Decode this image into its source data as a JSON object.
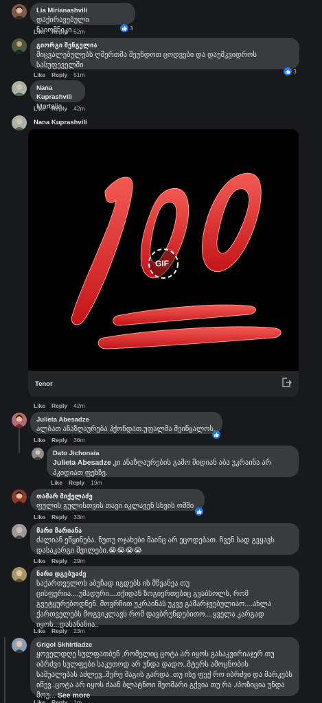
{
  "ui": {
    "like": "Like",
    "reply": "Reply",
    "like_color": "#1877f2",
    "bubble_color": "#3a3b3c",
    "background": "#18191a"
  },
  "comments": [
    {
      "author": "Lia Mirianashvili",
      "text": "დაქირავებული ნაიომნიკი..",
      "time": "52m",
      "reaction_count": "3"
    },
    {
      "author": "გიორგი შენგელია",
      "text": "მიცვალებულებს ღმერთმა შეუნდოთ ცოდვები და დაუმკვიდროს სასუფეველში",
      "time": "51m",
      "reaction_count": "3"
    },
    {
      "author": "Nana Kuprashvili",
      "text": "Martalia",
      "time": "42m"
    },
    {
      "author": "Nana Kuprashvili",
      "gif_label": "GIF",
      "gif_source": "Tenor",
      "gif_number": "100",
      "time": "42m"
    },
    {
      "author": "Julieta Abesadze",
      "text": "ალბათ ანაზღაურება ჰქონდათ.უფალმა შეიწყალოს.",
      "time": "36m"
    },
    {
      "author": "Dato Jichonaia",
      "mention": "Julieta Abesadze",
      "text": " კი ანაზღაურების გამო მიდიან აბა უკრაინა არ პკიდიათ ფეხზე.",
      "time": "19m"
    },
    {
      "author": "თამარ მიქელაძე",
      "text": "ფულის გულისთვის თავი იკლავენ სხვის ომში",
      "time": "33m"
    },
    {
      "author": "მარი მარიანა",
      "text_line1": "ძალიან ეწყინება. ნუთუ ოჯახები მაინც არ ეცოდებათ. ჩვენ სად გვყავს",
      "text_line2": "დასაკარგი შვილები.😭😭😭😭",
      "time": "29m"
    },
    {
      "author": "ნარი დგებუაძე",
      "text_lines": [
        "საქართველოს აბუჩად იგდებს ის მწვანეა თუ",
        "ცისფერია....უმადური....იქიდან ზოგიერთებიც გვაბსოლს, რომ",
        "გვეტყურებოდნენ. მოვრჩით უკრაინას უკვე გამარჯვებულიაო....ახლა",
        "ქართველებს მოგვიკლავს რომ დავბრუნდებითო....ყველა კარგად",
        "იყოს...დასანანია.."
      ],
      "time": "23m"
    },
    {
      "author": "Grigol Skhirtladze",
      "text_lines": [
        "ყოველდღე სულფათბენ ,რომელიც ცოტა არ იყოს გასაკვირიაჯერ თუ",
        "იბრძვი სულფები საკუთოდ არ უნდა დადო..მტერს ამოცნობის",
        "საშუალებას აძლევ..მერე მაგის გარდა..თუ ისე ფექ რო იბრძვი და მარკებს",
        "იწევ..ცოტა არ იყოს ძაან ბლატნოი მეომარი გქვია თუ რა ./პოზიცია უნდა"
      ],
      "text_tail": "მოუ...",
      "see_more": "See more",
      "time": "1m"
    }
  ]
}
